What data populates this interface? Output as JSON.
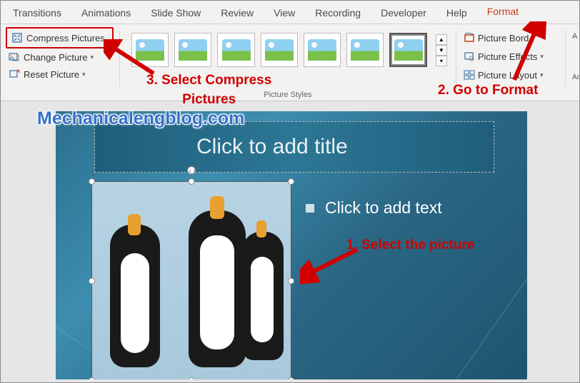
{
  "tabs": {
    "transitions": "Transitions",
    "animations": "Animations",
    "slideshow": "Slide Show",
    "review": "Review",
    "view": "View",
    "recording": "Recording",
    "developer": "Developer",
    "help": "Help",
    "format": "Format"
  },
  "adjust": {
    "compress": "Compress Pictures",
    "change": "Change Picture",
    "reset": "Reset Picture"
  },
  "styles": {
    "label": "Picture Styles"
  },
  "format_group": {
    "border": "Picture Bord",
    "effects": "Picture Effects",
    "layout": "Picture Layout"
  },
  "right_edge": {
    "a": "A",
    "acc": "Acce"
  },
  "slide": {
    "title_placeholder": "Click to add title",
    "content_placeholder": "Click to add text"
  },
  "watermark": "Mechanicalengblog.com",
  "annotations": {
    "a1": "1.  Select the picture",
    "a2": "2. Go to Format",
    "a3a": "3. Select Compress",
    "a3b": "Pictures"
  }
}
